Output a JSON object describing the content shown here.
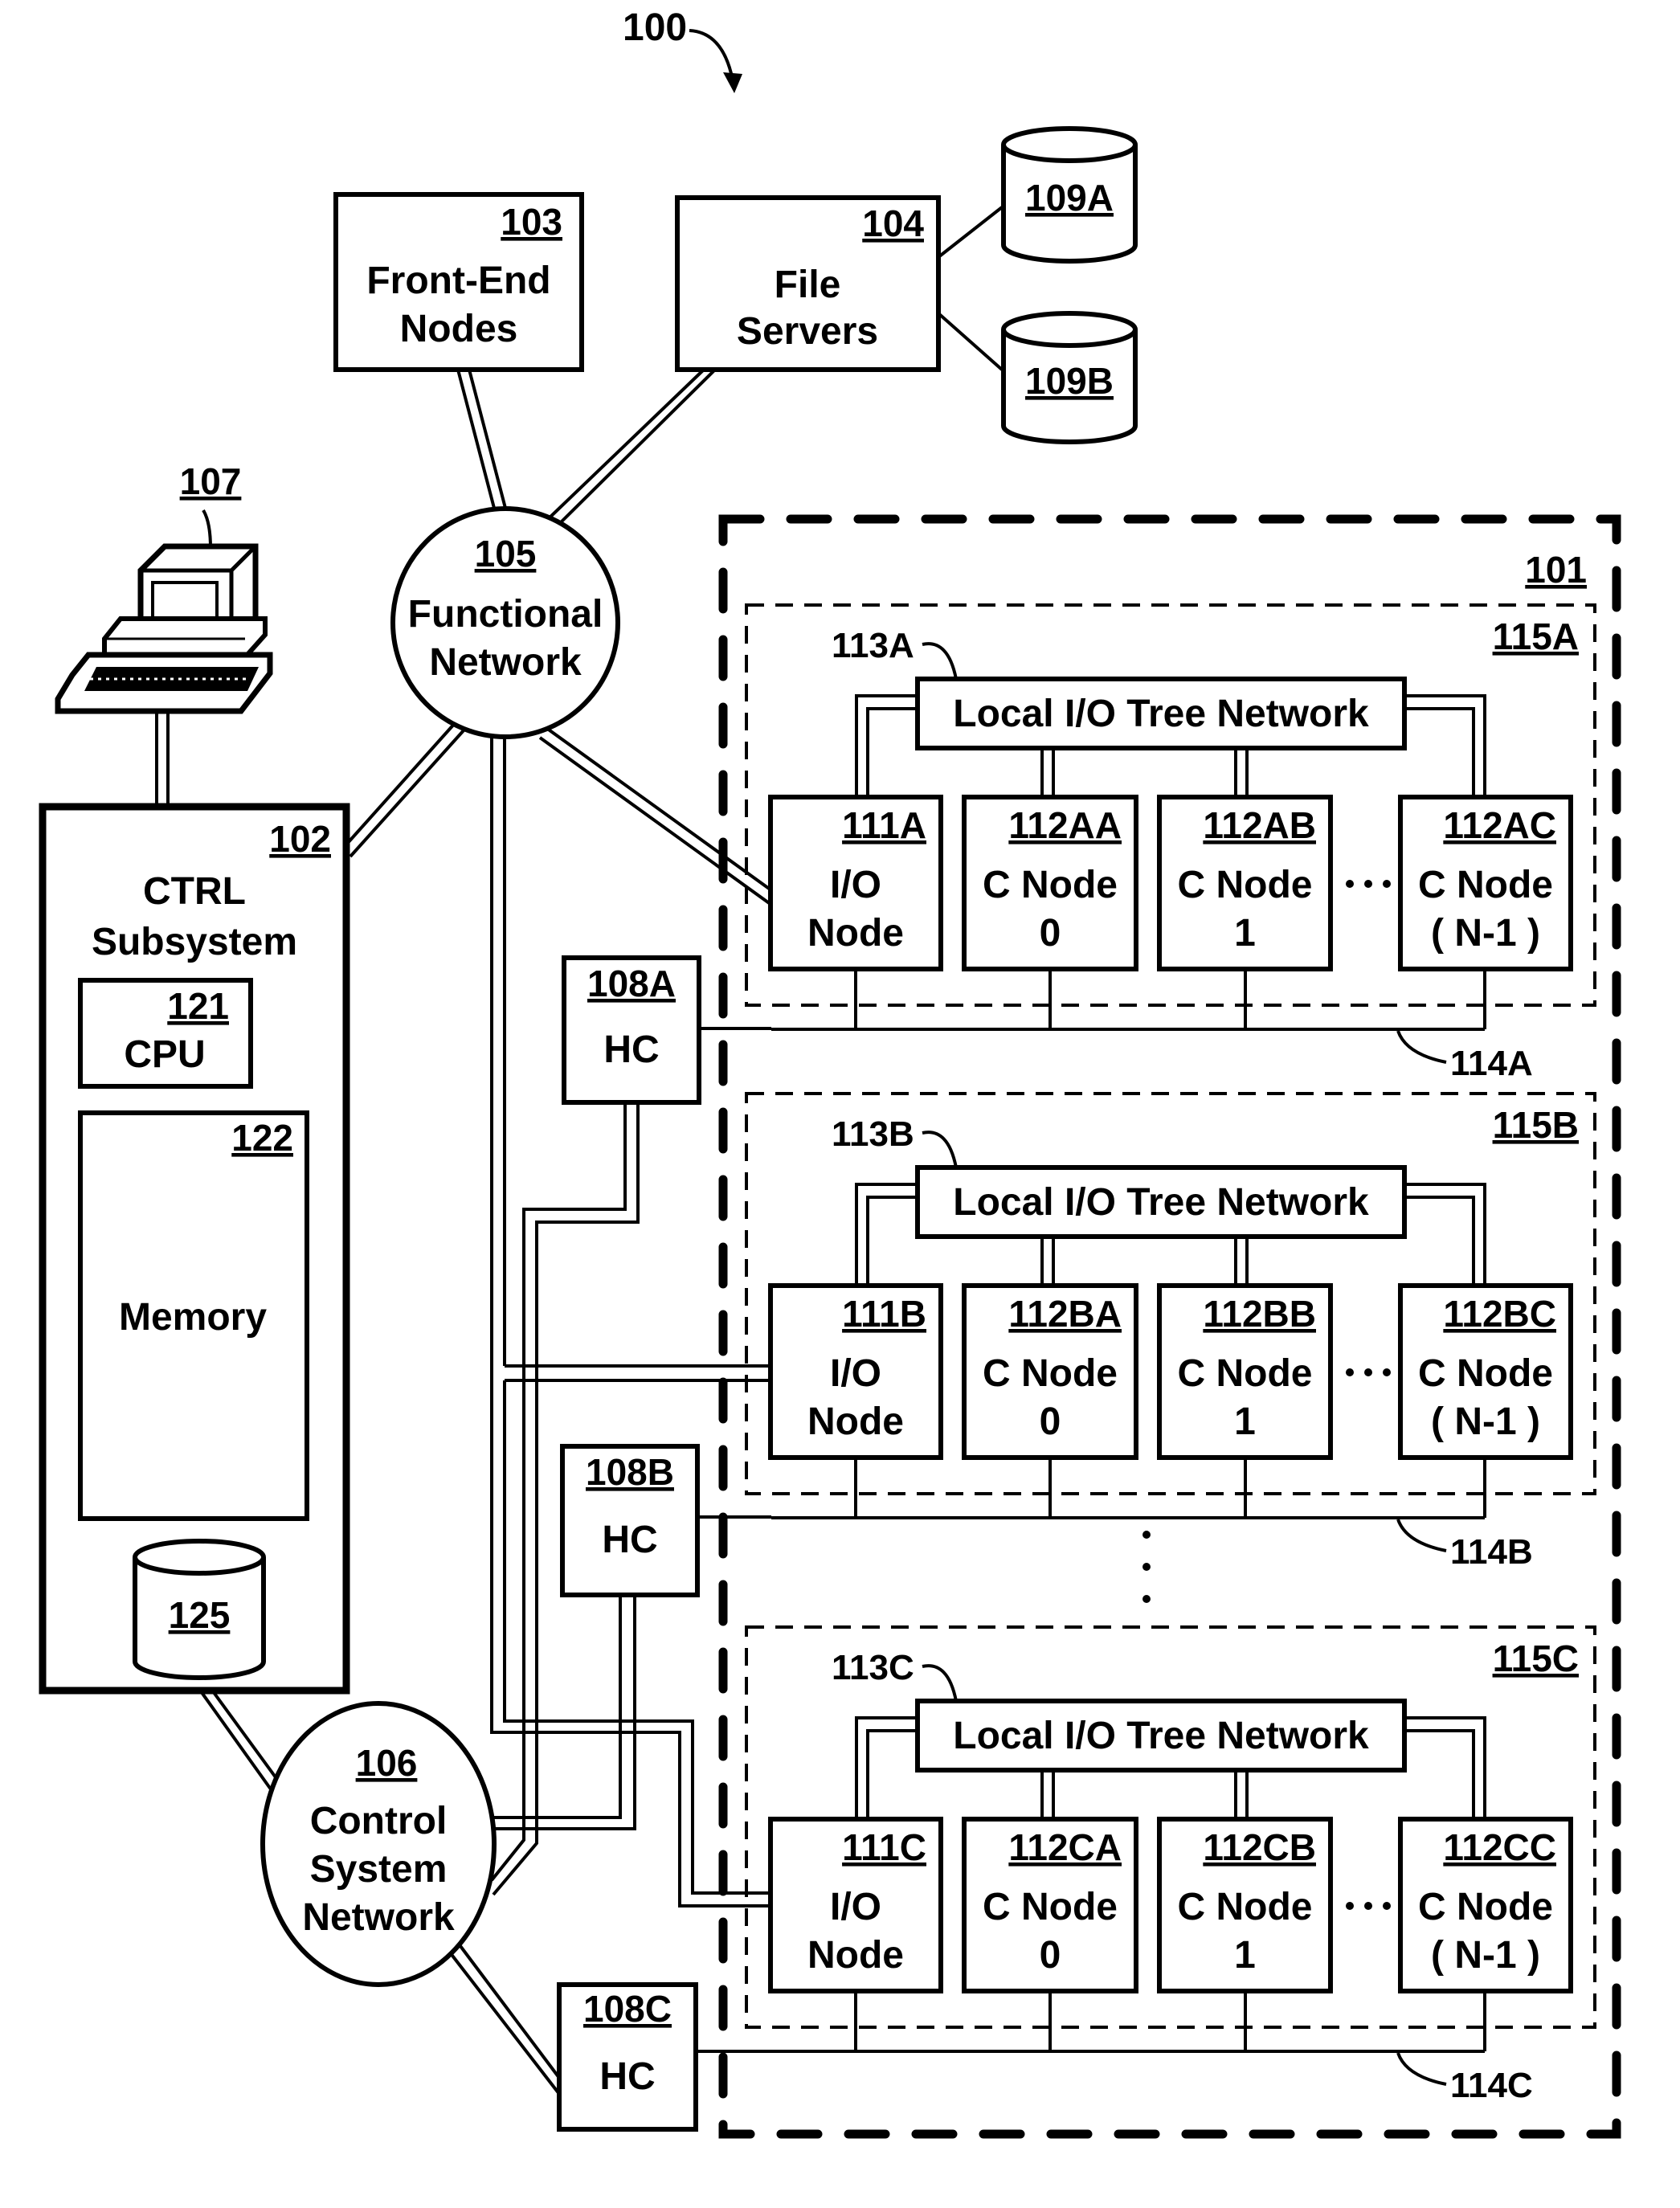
{
  "figure": {
    "ref": "100",
    "colors": {
      "ink": "#000000",
      "paper": "#ffffff"
    }
  },
  "front_end_nodes": {
    "ref": "103",
    "line1": "Front-End",
    "line2": "Nodes"
  },
  "file_servers": {
    "ref": "104",
    "line1": "File",
    "line2": "Servers"
  },
  "storage": [
    {
      "ref": "109A"
    },
    {
      "ref": "109B"
    }
  ],
  "functional_network": {
    "ref": "105",
    "line1": "Functional",
    "line2": "Network"
  },
  "workstation": {
    "ref": "107",
    "icon": "computer-workstation-icon"
  },
  "ctrl_subsystem": {
    "ref": "102",
    "line1": "CTRL",
    "line2": "Subsystem",
    "cpu": {
      "ref": "121",
      "label": "CPU"
    },
    "memory": {
      "ref": "122",
      "label": "Memory"
    },
    "disk": {
      "ref": "125"
    }
  },
  "control_network": {
    "ref": "106",
    "line1": "Control",
    "line2": "System",
    "line3": "Network"
  },
  "hardware_controllers": [
    {
      "ref": "108A",
      "label": "HC"
    },
    {
      "ref": "108B",
      "label": "HC"
    },
    {
      "ref": "108C",
      "label": "HC"
    }
  ],
  "cluster_container": {
    "ref": "101"
  },
  "clusters": [
    {
      "ref": "115A",
      "tree_ref": "113A",
      "bus_ref": "114A",
      "tree_label": "Local I/O Tree Network",
      "nodes": [
        {
          "ref": "111A",
          "line1": "I/O",
          "line2": "Node"
        },
        {
          "ref": "112AA",
          "line1": "C Node",
          "line2": "0"
        },
        {
          "ref": "112AB",
          "line1": "C Node",
          "line2": "1"
        },
        {
          "ref": "112AC",
          "line1": "C Node",
          "line2": "( N-1 )"
        }
      ]
    },
    {
      "ref": "115B",
      "tree_ref": "113B",
      "bus_ref": "114B",
      "tree_label": "Local I/O Tree Network",
      "nodes": [
        {
          "ref": "111B",
          "line1": "I/O",
          "line2": "Node"
        },
        {
          "ref": "112BA",
          "line1": "C Node",
          "line2": "0"
        },
        {
          "ref": "112BB",
          "line1": "C Node",
          "line2": "1"
        },
        {
          "ref": "112BC",
          "line1": "C Node",
          "line2": "( N-1 )"
        }
      ]
    },
    {
      "ref": "115C",
      "tree_ref": "113C",
      "bus_ref": "114C",
      "tree_label": "Local I/O Tree Network",
      "nodes": [
        {
          "ref": "111C",
          "line1": "I/O",
          "line2": "Node"
        },
        {
          "ref": "112CA",
          "line1": "C Node",
          "line2": "0"
        },
        {
          "ref": "112CB",
          "line1": "C Node",
          "line2": "1"
        },
        {
          "ref": "112CC",
          "line1": "C Node",
          "line2": "( N-1 )"
        }
      ]
    }
  ]
}
